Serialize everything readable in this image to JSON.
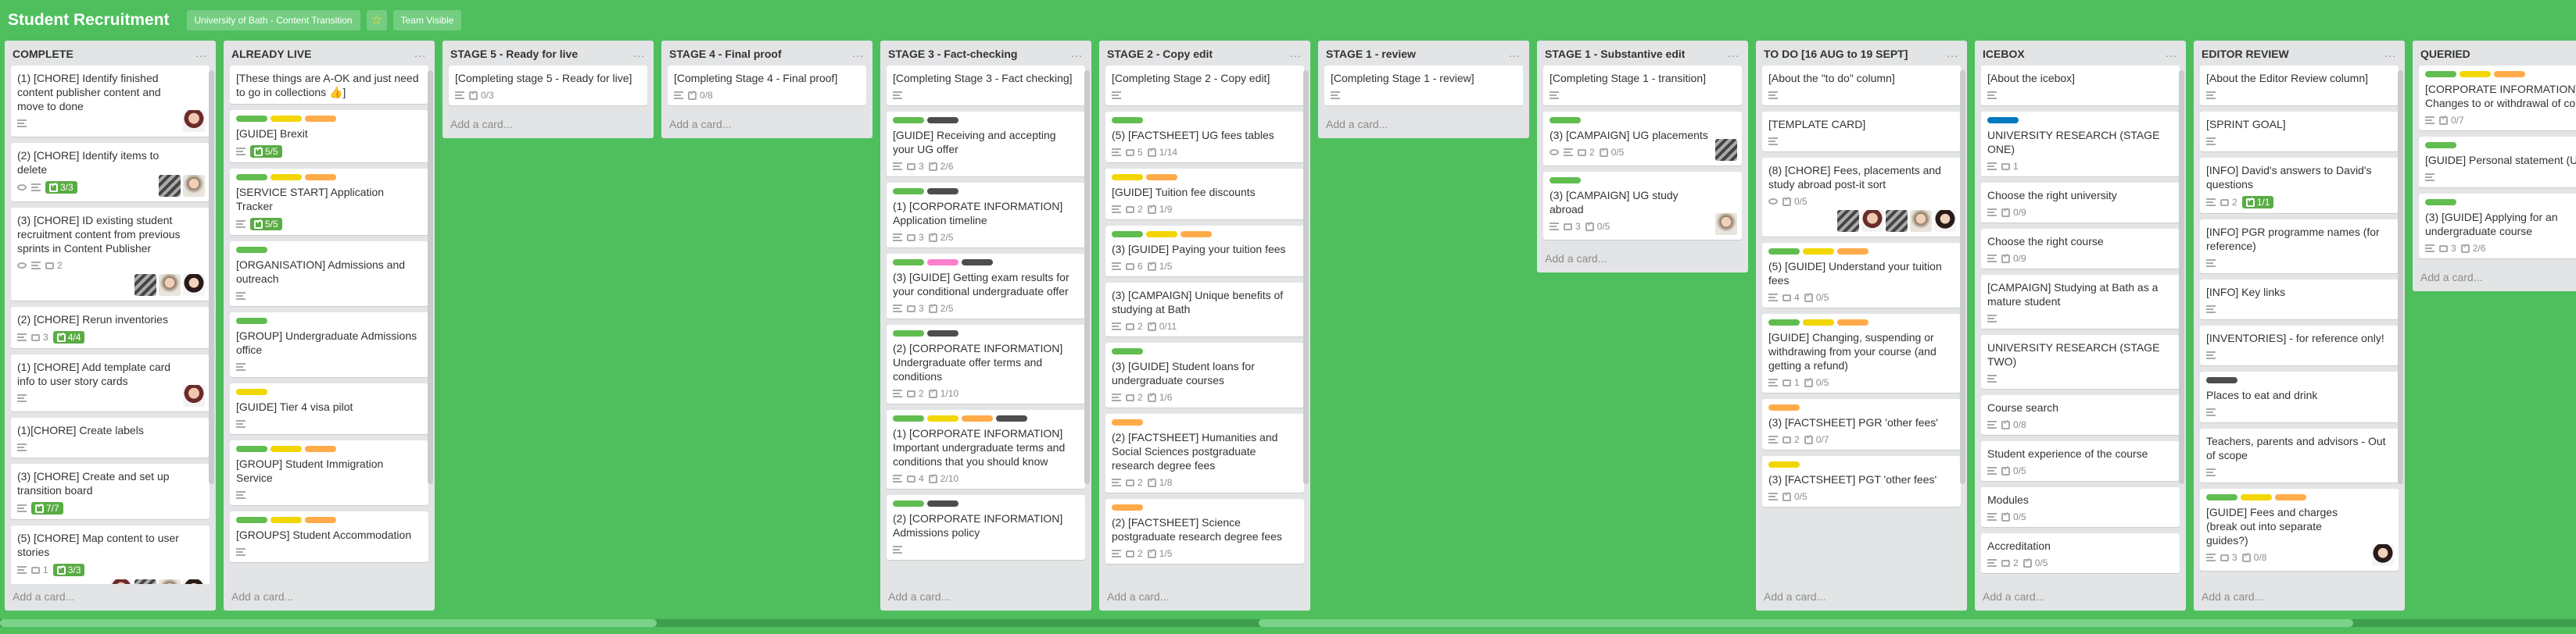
{
  "header": {
    "title": "Student Recruitment",
    "org": "University of Bath - Content Transition",
    "visibility": "Team Visible"
  },
  "colors": {
    "green": "#61bd4f",
    "yellow": "#f2d600",
    "orange": "#ffab4a",
    "dark": "#4d4d4d",
    "pink": "#ff80ce",
    "blue": "#0079bf",
    "purple": "#c377e0"
  },
  "add_card_label": "Add a card...",
  "lists": [
    {
      "name": "COMPLETE",
      "full": true,
      "cards": [
        {
          "title": "(1) [CHORE] Identify finished content publisher content and move to done",
          "desc": true,
          "avatars": [
            "a1"
          ]
        },
        {
          "title": "(2) [CHORE] Identify items to delete",
          "eye": true,
          "desc": true,
          "checklist_done": "3/3",
          "avatars": [
            "a3",
            "a2"
          ]
        },
        {
          "title": "(3) [CHORE] ID existing student recruitment content from previous sprints in Content Publisher",
          "eye": true,
          "desc": true,
          "comments": "2",
          "avatars": [
            "a3",
            "a2",
            "a4"
          ]
        },
        {
          "title": "(2) [CHORE] Rerun inventories",
          "desc": true,
          "comments": "3",
          "checklist_done": "4/4"
        },
        {
          "title": "(1) [CHORE] Add template card info to user story cards",
          "desc": true,
          "avatars": [
            "a1"
          ]
        },
        {
          "title": "(1)[CHORE] Create labels",
          "desc": true
        },
        {
          "title": "(3) [CHORE] Create and set up transition board",
          "desc": true,
          "checklist_done": "7/7"
        },
        {
          "title": "(5) [CHORE] Map content to user stories",
          "desc": true,
          "comments": "1",
          "checklist_done": "3/3",
          "avatars": [
            "a1",
            "a3",
            "a2",
            "a4"
          ]
        }
      ]
    },
    {
      "name": "ALREADY LIVE",
      "full": true,
      "cards": [
        {
          "title": "[These things are A-OK and just need to go in collections 👍]"
        },
        {
          "labels": [
            "green",
            "yellow",
            "orange"
          ],
          "title": "[GUIDE] Brexit",
          "desc": true,
          "checklist_done": "5/5"
        },
        {
          "labels": [
            "green",
            "yellow",
            "orange"
          ],
          "title": "[SERVICE START] Application Tracker",
          "desc": true,
          "checklist_done": "5/5"
        },
        {
          "labels": [
            "green"
          ],
          "title": "[ORGANISATION] Admissions and outreach",
          "desc": true
        },
        {
          "labels": [
            "green"
          ],
          "title": "[GROUP] Undergraduate Admissions office",
          "desc": true
        },
        {
          "labels": [
            "yellow"
          ],
          "title": "[GUIDE] Tier 4 visa pilot",
          "desc": true
        },
        {
          "labels": [
            "green",
            "yellow",
            "orange"
          ],
          "title": "[GROUP] Student Immigration Service",
          "desc": true
        },
        {
          "labels": [
            "green",
            "yellow",
            "orange"
          ],
          "title": "[GROUPS] Student Accommodation",
          "desc": true
        }
      ]
    },
    {
      "name": "STAGE 5 - Ready for live",
      "full": false,
      "cards": [
        {
          "title": "[Completing stage 5 - Ready for live]",
          "desc": true,
          "checklist": "0/3"
        }
      ]
    },
    {
      "name": "STAGE 4 - Final proof",
      "full": false,
      "cards": [
        {
          "title": "[Completing Stage 4 - Final proof]",
          "desc": true,
          "checklist": "0/8"
        }
      ]
    },
    {
      "name": "STAGE 3 - Fact-checking",
      "full": true,
      "cards": [
        {
          "title": "[Completing Stage 3 - Fact checking]",
          "desc": true
        },
        {
          "labels": [
            "green",
            "dark"
          ],
          "title": "[GUIDE] Receiving and accepting your UG offer",
          "desc": true,
          "comments": "3",
          "checklist": "2/6"
        },
        {
          "labels": [
            "green",
            "dark"
          ],
          "title": "(1) [CORPORATE INFORMATION] Application timeline",
          "desc": true,
          "comments": "3",
          "checklist": "2/5"
        },
        {
          "labels": [
            "green",
            "pink",
            "dark"
          ],
          "title": "(3) [GUIDE] Getting exam results for your conditional undergraduate offer",
          "desc": true,
          "comments": "3",
          "checklist": "2/5"
        },
        {
          "labels": [
            "green",
            "dark"
          ],
          "title": "(2) [CORPORATE INFORMATION] Undergraduate offer terms and conditions",
          "desc": true,
          "comments": "2",
          "checklist": "1/10"
        },
        {
          "labels": [
            "green",
            "yellow",
            "orange",
            "dark"
          ],
          "title": "(1) [CORPORATE INFORMATION] Important undergraduate terms and conditions that you should know",
          "desc": true,
          "comments": "4",
          "checklist": "2/10"
        },
        {
          "labels": [
            "green",
            "dark"
          ],
          "title": "(2) [CORPORATE INFORMATION] Admissions policy",
          "desc": true
        }
      ]
    },
    {
      "name": "STAGE 2 - Copy edit",
      "full": true,
      "cards": [
        {
          "title": "[Completing Stage 2 - Copy edit]",
          "desc": true
        },
        {
          "labels": [
            "green"
          ],
          "title": "(5) [FACTSHEET] UG fees tables",
          "desc": true,
          "comments": "5",
          "checklist": "1/14"
        },
        {
          "labels": [
            "yellow",
            "orange"
          ],
          "title": "[GUIDE] Tuition fee discounts",
          "desc": true,
          "comments": "2",
          "checklist": "1/9"
        },
        {
          "labels": [
            "green",
            "yellow",
            "orange"
          ],
          "title": "(3) [GUIDE] Paying your tuition fees",
          "desc": true,
          "comments": "6",
          "checklist": "1/5"
        },
        {
          "title": "(3) [CAMPAIGN] Unique benefits of studying at Bath",
          "desc": true,
          "comments": "2",
          "checklist": "0/11"
        },
        {
          "labels": [
            "green"
          ],
          "title": "(3) [GUIDE] Student loans for undergraduate courses",
          "desc": true,
          "comments": "2",
          "checklist": "1/6"
        },
        {
          "labels": [
            "orange"
          ],
          "title": "(2) [FACTSHEET] Humanities and Social Sciences postgraduate research degree fees",
          "desc": true,
          "comments": "2",
          "checklist": "1/8"
        },
        {
          "labels": [
            "orange"
          ],
          "title": "(2) [FACTSHEET] Science postgraduate research degree fees",
          "desc": true,
          "comments": "2",
          "checklist": "1/5"
        }
      ]
    },
    {
      "name": "STAGE 1 - review",
      "full": false,
      "cards": [
        {
          "title": "[Completing Stage 1 - review]",
          "desc": true
        }
      ]
    },
    {
      "name": "STAGE 1 - Substantive edit",
      "full": false,
      "cards": [
        {
          "title": "[Completing Stage 1 - transition]",
          "desc": true
        },
        {
          "labels": [
            "green"
          ],
          "title": "(3) [CAMPAIGN] UG placements",
          "eye": true,
          "desc": true,
          "comments": "2",
          "checklist": "0/5",
          "avatars": [
            "a3"
          ]
        },
        {
          "labels": [
            "green"
          ],
          "title": "(3) [CAMPAIGN] UG study abroad",
          "desc": true,
          "comments": "3",
          "checklist": "0/5",
          "avatars": [
            "a2"
          ]
        }
      ]
    },
    {
      "name": "TO DO [16 AUG to 19 SEPT]",
      "full": true,
      "cards": [
        {
          "title": "[About the \"to do\" column]",
          "desc": true
        },
        {
          "title": "[TEMPLATE CARD]",
          "desc": true
        },
        {
          "title": "(8) [CHORE] Fees, placements and study abroad post-it sort",
          "eye": true,
          "checklist": "0/5",
          "avatars": [
            "a3",
            "a1",
            "a3",
            "a2",
            "a4"
          ]
        },
        {
          "labels": [
            "green",
            "yellow",
            "orange"
          ],
          "title": "(5) [GUIDE] Understand your tuition fees",
          "desc": true,
          "comments": "4",
          "checklist": "0/5"
        },
        {
          "labels": [
            "green",
            "yellow",
            "orange"
          ],
          "title": "[GUIDE] Changing, suspending or withdrawing from your course (and getting a refund)",
          "desc": true,
          "comments": "1",
          "checklist": "0/5"
        },
        {
          "labels": [
            "orange"
          ],
          "title": "(3) [FACTSHEET] PGR 'other fees'",
          "desc": true,
          "comments": "2",
          "checklist": "0/7"
        },
        {
          "labels": [
            "yellow"
          ],
          "title": "(3) [FACTSHEET] PGT 'other fees'",
          "desc": true,
          "checklist": "0/5"
        }
      ]
    },
    {
      "name": "ICEBOX",
      "full": true,
      "cards": [
        {
          "title": "[About the icebox]",
          "desc": true
        },
        {
          "labels": [
            "blue"
          ],
          "title": "UNIVERSITY RESEARCH (STAGE ONE)",
          "desc": true,
          "comments": "1"
        },
        {
          "title": "Choose the right university",
          "desc": true,
          "checklist": "0/9"
        },
        {
          "title": "Choose the right course",
          "desc": true,
          "checklist": "0/9"
        },
        {
          "title": "[CAMPAIGN] Studying at Bath as a mature student",
          "desc": true
        },
        {
          "title": "UNIVERSITY RESEARCH (STAGE TWO)",
          "desc": true
        },
        {
          "title": "Course search",
          "desc": true,
          "checklist": "0/8"
        },
        {
          "title": "Student experience of the course",
          "desc": true,
          "checklist": "0/5"
        },
        {
          "title": "Modules",
          "desc": true,
          "checklist": "0/5"
        },
        {
          "title": "Accreditation",
          "desc": true,
          "comments": "2",
          "checklist": "0/5"
        }
      ]
    },
    {
      "name": "EDITOR REVIEW",
      "full": true,
      "cards": [
        {
          "title": "[About the Editor Review column]",
          "desc": true
        },
        {
          "title": "[SPRINT GOAL]",
          "desc": true
        },
        {
          "title": "[INFO] David's answers to David's questions",
          "desc": true,
          "comments": "2",
          "checklist_done": "1/1"
        },
        {
          "title": "[INFO] PGR programme names (for reference)",
          "desc": true
        },
        {
          "title": "[INFO] Key links",
          "desc": true
        },
        {
          "title": "[INVENTORIES] - for reference only!",
          "desc": true
        },
        {
          "labels": [
            "dark"
          ],
          "title": "Places to eat and drink",
          "desc": true
        },
        {
          "title": "Teachers, parents and advisors - Out of scope",
          "desc": true
        },
        {
          "labels": [
            "green",
            "yellow",
            "orange"
          ],
          "title": "[GUIDE] Fees and charges (break out into separate guides?)",
          "desc": true,
          "comments": "3",
          "checklist": "0/8",
          "avatars": [
            "a4"
          ]
        }
      ]
    },
    {
      "name": "QUERIED",
      "full": false,
      "cards": [
        {
          "labels": [
            "green",
            "yellow",
            "orange"
          ],
          "title": "[CORPORATE INFORMATION] Changes to or withdrawal of courses",
          "desc": true,
          "checklist": "0/7"
        },
        {
          "labels": [
            "green"
          ],
          "title": "[GUIDE] Personal statement (UCAS)",
          "desc": true
        },
        {
          "labels": [
            "green"
          ],
          "title": "(3) [GUIDE] Applying for an undergraduate course",
          "desc": true,
          "comments": "3",
          "checklist": "2/6"
        }
      ]
    }
  ]
}
